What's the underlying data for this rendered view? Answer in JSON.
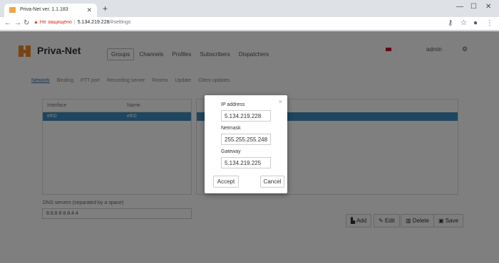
{
  "browser": {
    "tab_title": "Priva-Net ver. 1.1.183",
    "new_tab": "+",
    "security_warning": "Не защищено",
    "host": "5.134.219.228",
    "path": "/#settings"
  },
  "app": {
    "brand": "Priva-Net",
    "nav": [
      "Groups",
      "Channels",
      "Profiles",
      "Subscribers",
      "Dispatchers"
    ],
    "active_nav": "Groups",
    "user": "admin"
  },
  "settings": {
    "subtabs": [
      "Network",
      "Binding",
      "PTT port",
      "Recording server",
      "Rooms",
      "Update",
      "Client updates"
    ],
    "active_subtab": "Network",
    "table": {
      "headers": [
        "Interface",
        "Name"
      ],
      "rows": [
        [
          "eth0",
          "eth0"
        ]
      ]
    },
    "dns_label": "DNS servers (separated by a space)",
    "dns_value": "8.8.8.8 8.8.4.4",
    "buttons": {
      "add": "Add",
      "edit": "Edit",
      "delete": "Delete",
      "save": "Save"
    }
  },
  "modal": {
    "ip_label": "IP address",
    "ip_value": "5.134.219.228",
    "netmask_label": "Netmask",
    "netmask_value": "255.255.255.248",
    "gateway_label": "Gateway",
    "gateway_value": "5.134.219.225",
    "accept": "Accept",
    "cancel": "Cancel",
    "close": "×"
  }
}
